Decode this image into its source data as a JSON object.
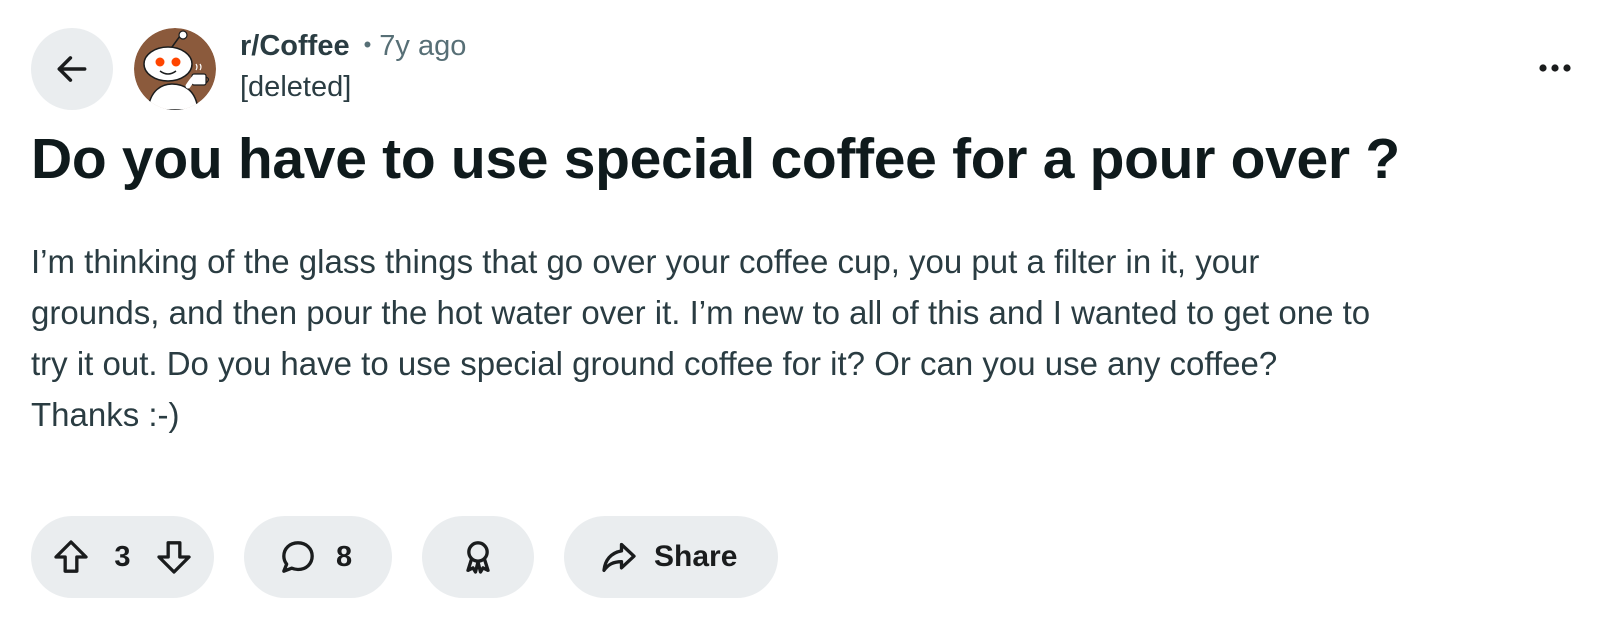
{
  "header": {
    "subreddit": "r/Coffee",
    "separator": "•",
    "time_ago": "7y ago",
    "author": "[deleted]",
    "icons": {
      "back": "arrow-left-icon",
      "avatar": "reddit-snoo-coffee-avatar",
      "more": "more-horizontal-icon"
    }
  },
  "post": {
    "title": "Do you have to use special coffee for a pour over ?",
    "body_lines": [
      "I’m thinking of the glass things that go over your coffee cup, you put a filter in it, your",
      "grounds, and then pour the hot water over it. I’m new to all of this and I wanted to get one to",
      "try it out. Do you have to use special ground coffee for it? Or can you use any coffee?",
      "Thanks :-)"
    ]
  },
  "actions": {
    "vote_count": "3",
    "comment_count": "8",
    "share_label": "Share",
    "icons": {
      "upvote": "upvote-arrow-icon",
      "downvote": "downvote-arrow-icon",
      "comment": "comment-bubble-icon",
      "award": "award-ribbon-icon",
      "share": "share-arrow-icon"
    }
  },
  "colors": {
    "pill_background": "#eaedef",
    "avatar_brown": "#8b5a3c",
    "snoo_eye_orange": "#ff4500",
    "muted_text": "#576f76"
  }
}
